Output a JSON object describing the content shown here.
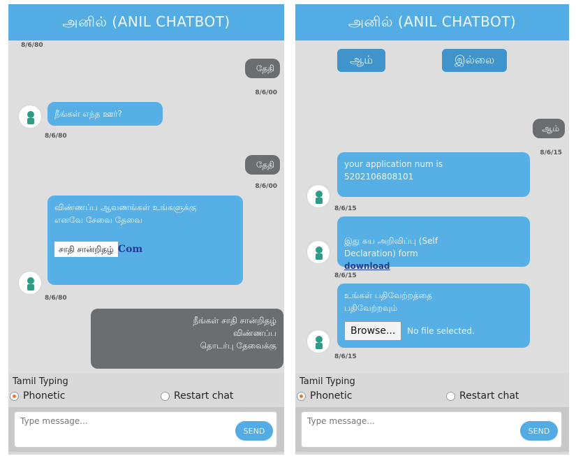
{
  "left": {
    "header_title": "அனில் (ANIL CHATBOT)",
    "times": {
      "t0": "8/6/80",
      "t1": "8/6/00",
      "t2": "8/6/80",
      "t3": "8/6/00",
      "t4": "8/6/80"
    },
    "messages": {
      "user_reply_1": "தேதி",
      "bot_1": "நீங்கள் எந்த ஊர்?",
      "user_reply_2": "தேதி",
      "bot_2_text": "விண்ணப்ப ஆவணங்கள் உங்களுக்கு\nஎனவே சேவை தேவை",
      "bot_2_box": "சாதி சான்றிதழ்",
      "bot_2_suffix": "Com",
      "user_long": "நீங்கள் சாதி சான்றிதழ்\nவிண்ணப்ப\nதொடர்பு தேவைக்கு"
    },
    "typing": {
      "title": "Tamil Typing",
      "option_phonetic": "Phonetic",
      "option_restart": "Restart chat",
      "placeholder": "Type message...",
      "send_label": "SEND"
    }
  },
  "right": {
    "header_title": "அனில் (ANIL CHATBOT)",
    "top_pills": [
      "ஆம்",
      "இல்லை"
    ],
    "times": {
      "t1": "8/6/15",
      "t2": "8/6/15",
      "t3": "8/6/15",
      "t4": "8/6/15"
    },
    "messages": {
      "user_short": "ஆம்",
      "bot_1": "your application num is\n5202106808101",
      "bot_2_prefix": "இது சுய அறிவிப்பு (Self\nDeclaration) form",
      "bot_2_link": "download",
      "bot_3_text": "உங்கள் பதிவேற்றத்தை\nபதிவேற்றவும்",
      "browse_label": "Browse...",
      "no_file": "No file selected."
    },
    "typing": {
      "title": "Tamil Typing",
      "option_phonetic": "Phonetic",
      "option_restart": "Restart chat",
      "placeholder": "Type message...",
      "send_label": "SEND"
    }
  }
}
